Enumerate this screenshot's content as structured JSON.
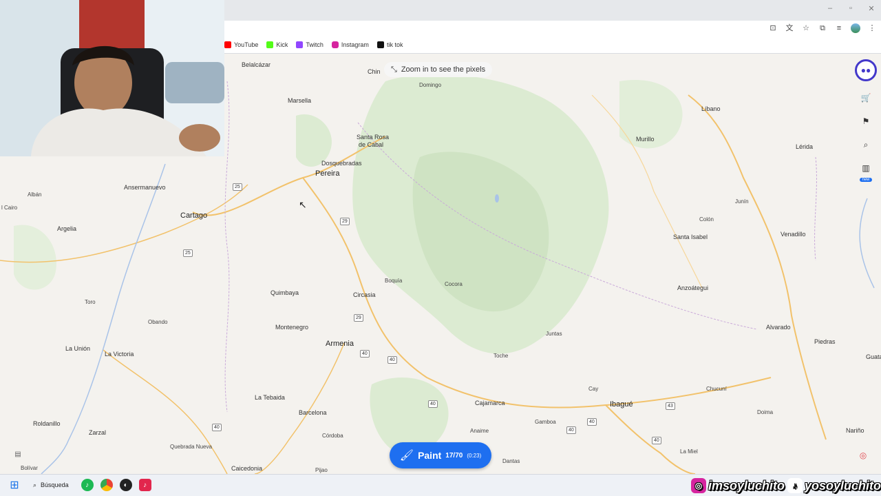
{
  "browser": {
    "window_controls": [
      "–",
      "▫",
      "✕"
    ],
    "bookmarks": [
      {
        "label": "YouTube",
        "color": "#ff0000"
      },
      {
        "label": "Kick",
        "color": "#53fc18"
      },
      {
        "label": "Twitch",
        "color": "#9146ff"
      },
      {
        "label": "Instagram",
        "color": "#d6249f"
      },
      {
        "label": "tik tok",
        "color": "#111111"
      }
    ]
  },
  "map": {
    "zoom_hint": "Zoom in to see the pixels",
    "paint_button": {
      "label": "Paint",
      "count": "17/70",
      "timer": "(0:23)"
    },
    "places": [
      {
        "name": "Belalcázar",
        "cls": "place"
      },
      {
        "name": "Chin",
        "cls": "place"
      },
      {
        "name": "Domingo",
        "cls": "place small"
      },
      {
        "name": "Marsella",
        "cls": "place"
      },
      {
        "name": "Santa Rosa",
        "cls": "place"
      },
      {
        "name": "de Cabal",
        "cls": "place"
      },
      {
        "name": "Dosquebradas",
        "cls": "place"
      },
      {
        "name": "Pereira",
        "cls": "place city"
      },
      {
        "name": "Ansermanuevo",
        "cls": "place"
      },
      {
        "name": "Albán",
        "cls": "place small"
      },
      {
        "name": "l Cairo",
        "cls": "place small"
      },
      {
        "name": "Cartago",
        "cls": "place city"
      },
      {
        "name": "Argelia",
        "cls": "place"
      },
      {
        "name": "Líbano",
        "cls": "place"
      },
      {
        "name": "Murillo",
        "cls": "place"
      },
      {
        "name": "Lérida",
        "cls": "place"
      },
      {
        "name": "Junín",
        "cls": "place small"
      },
      {
        "name": "Colón",
        "cls": "place small"
      },
      {
        "name": "Santa Isabel",
        "cls": "place"
      },
      {
        "name": "Venadillo",
        "cls": "place"
      },
      {
        "name": "Boquía",
        "cls": "place small"
      },
      {
        "name": "Cocora",
        "cls": "place small"
      },
      {
        "name": "Quimbaya",
        "cls": "place"
      },
      {
        "name": "Circasia",
        "cls": "place"
      },
      {
        "name": "Anzoátegui",
        "cls": "place"
      },
      {
        "name": "Toro",
        "cls": "place small"
      },
      {
        "name": "Obando",
        "cls": "place small"
      },
      {
        "name": "Montenegro",
        "cls": "place"
      },
      {
        "name": "Alvarado",
        "cls": "place"
      },
      {
        "name": "Juntas",
        "cls": "place small"
      },
      {
        "name": "Piedras",
        "cls": "place"
      },
      {
        "name": "Guata",
        "cls": "place"
      },
      {
        "name": "Armenia",
        "cls": "place city"
      },
      {
        "name": "La Unión",
        "cls": "place"
      },
      {
        "name": "La Victoria",
        "cls": "place"
      },
      {
        "name": "Toche",
        "cls": "place small"
      },
      {
        "name": "Cay",
        "cls": "place small"
      },
      {
        "name": "Chucuní",
        "cls": "place small"
      },
      {
        "name": "La Tebaida",
        "cls": "place"
      },
      {
        "name": "Cajamarca",
        "cls": "place"
      },
      {
        "name": "Ibagué",
        "cls": "place city"
      },
      {
        "name": "Barcelona",
        "cls": "place"
      },
      {
        "name": "Doima",
        "cls": "place small"
      },
      {
        "name": "Roldanillo",
        "cls": "place"
      },
      {
        "name": "Gamboa",
        "cls": "place small"
      },
      {
        "name": "Nariño",
        "cls": "place"
      },
      {
        "name": "Zarzal",
        "cls": "place"
      },
      {
        "name": "Anaime",
        "cls": "place small"
      },
      {
        "name": "Córdoba",
        "cls": "place small"
      },
      {
        "name": "Quebrada Nueva",
        "cls": "place small"
      },
      {
        "name": "La Miel",
        "cls": "place small"
      },
      {
        "name": "Dantas",
        "cls": "place small"
      },
      {
        "name": "Bolívar",
        "cls": "place small"
      },
      {
        "name": "Caicedonia",
        "cls": "place"
      },
      {
        "name": "Pijao",
        "cls": "place small"
      }
    ],
    "shields": [
      "25",
      "29",
      "25",
      "29",
      "40",
      "40",
      "40",
      "40",
      "40",
      "43",
      "40",
      "40"
    ]
  },
  "taskbar": {
    "search_label": "Búsqueda",
    "handles": [
      {
        "text": "imsoyluchito",
        "icon": "instagram-icon"
      },
      {
        "text": "yosoyluchito",
        "icon": "tiktok-icon"
      }
    ]
  }
}
